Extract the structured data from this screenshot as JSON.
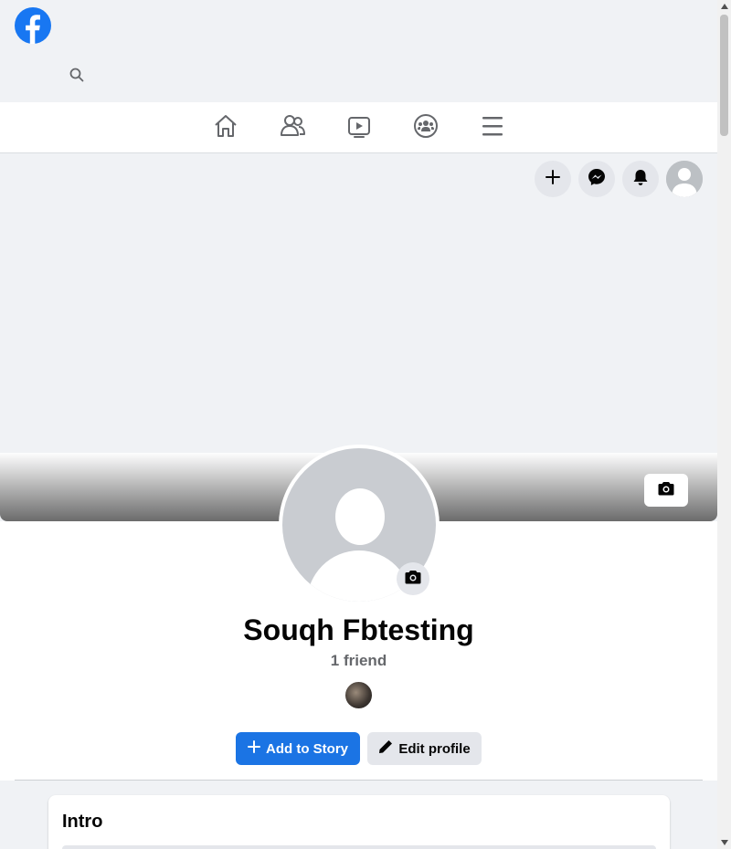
{
  "brand": {
    "name": "Facebook",
    "color": "#1877f2"
  },
  "topbar": {
    "search_icon": "search-icon"
  },
  "nav": {
    "items": [
      {
        "name": "home",
        "icon": "home-icon"
      },
      {
        "name": "friends",
        "icon": "friends-icon"
      },
      {
        "name": "watch",
        "icon": "video-icon"
      },
      {
        "name": "groups",
        "icon": "groups-icon"
      },
      {
        "name": "menu",
        "icon": "hamburger-menu-icon"
      }
    ]
  },
  "actions": {
    "create_icon": "plus-icon",
    "messenger_icon": "messenger-icon",
    "notifications_icon": "bell-icon",
    "account_icon": "account-avatar"
  },
  "profile": {
    "name": "Souqh Fbtesting",
    "friends_text": "1 friend",
    "add_story_label": "Add to Story",
    "edit_profile_label": "Edit profile"
  },
  "intro": {
    "title": "Intro"
  },
  "colors": {
    "primary_button": "#1b74e4",
    "secondary_button": "#e4e6eb",
    "page_background": "#f0f2f5"
  }
}
